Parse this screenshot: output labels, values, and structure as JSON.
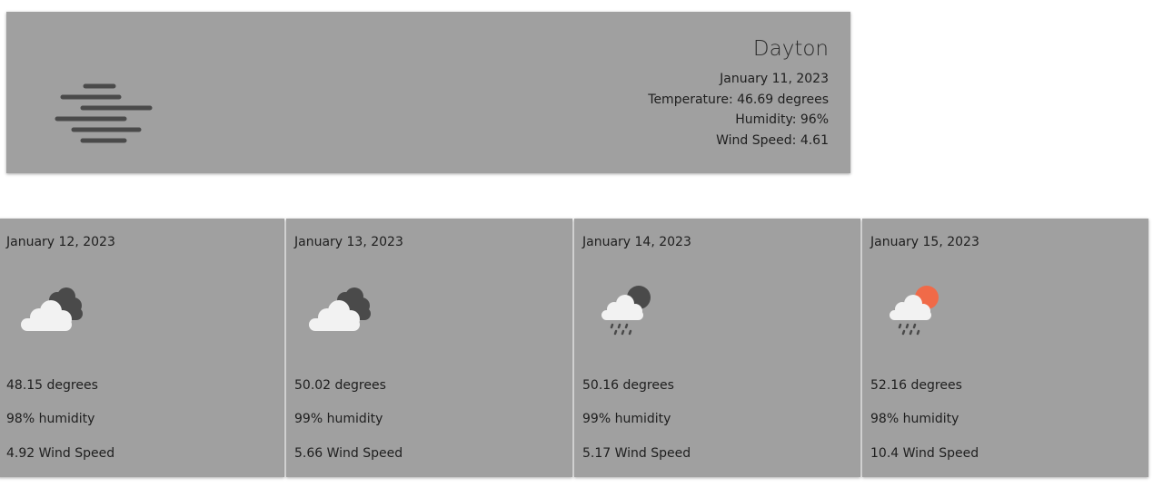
{
  "current": {
    "city": "Dayton",
    "date": "January 11, 2023",
    "temperature": "Temperature: 46.69 degrees",
    "humidity": "Humidity: 96%",
    "wind": "Wind Speed: 4.61",
    "icon": "fog-icon"
  },
  "forecast": [
    {
      "date": "January 12, 2023",
      "temp": "48.15 degrees",
      "humidity": "98% humidity",
      "wind": "4.92 Wind Speed",
      "icon": "broken-clouds-icon"
    },
    {
      "date": "January 13, 2023",
      "temp": "50.02 degrees",
      "humidity": "99% humidity",
      "wind": "5.66 Wind Speed",
      "icon": "broken-clouds-icon"
    },
    {
      "date": "January 14, 2023",
      "temp": "50.16 degrees",
      "humidity": "99% humidity",
      "wind": "5.17 Wind Speed",
      "icon": "night-rain-icon"
    },
    {
      "date": "January 15, 2023",
      "temp": "52.16 degrees",
      "humidity": "98% humidity",
      "wind": "10.4 Wind Speed",
      "icon": "day-rain-icon"
    }
  ],
  "colors": {
    "card": "#a0a0a0",
    "cloud_light": "#f2f2f2",
    "cloud_dark": "#4a4a4a",
    "sun": "#f06a48"
  }
}
